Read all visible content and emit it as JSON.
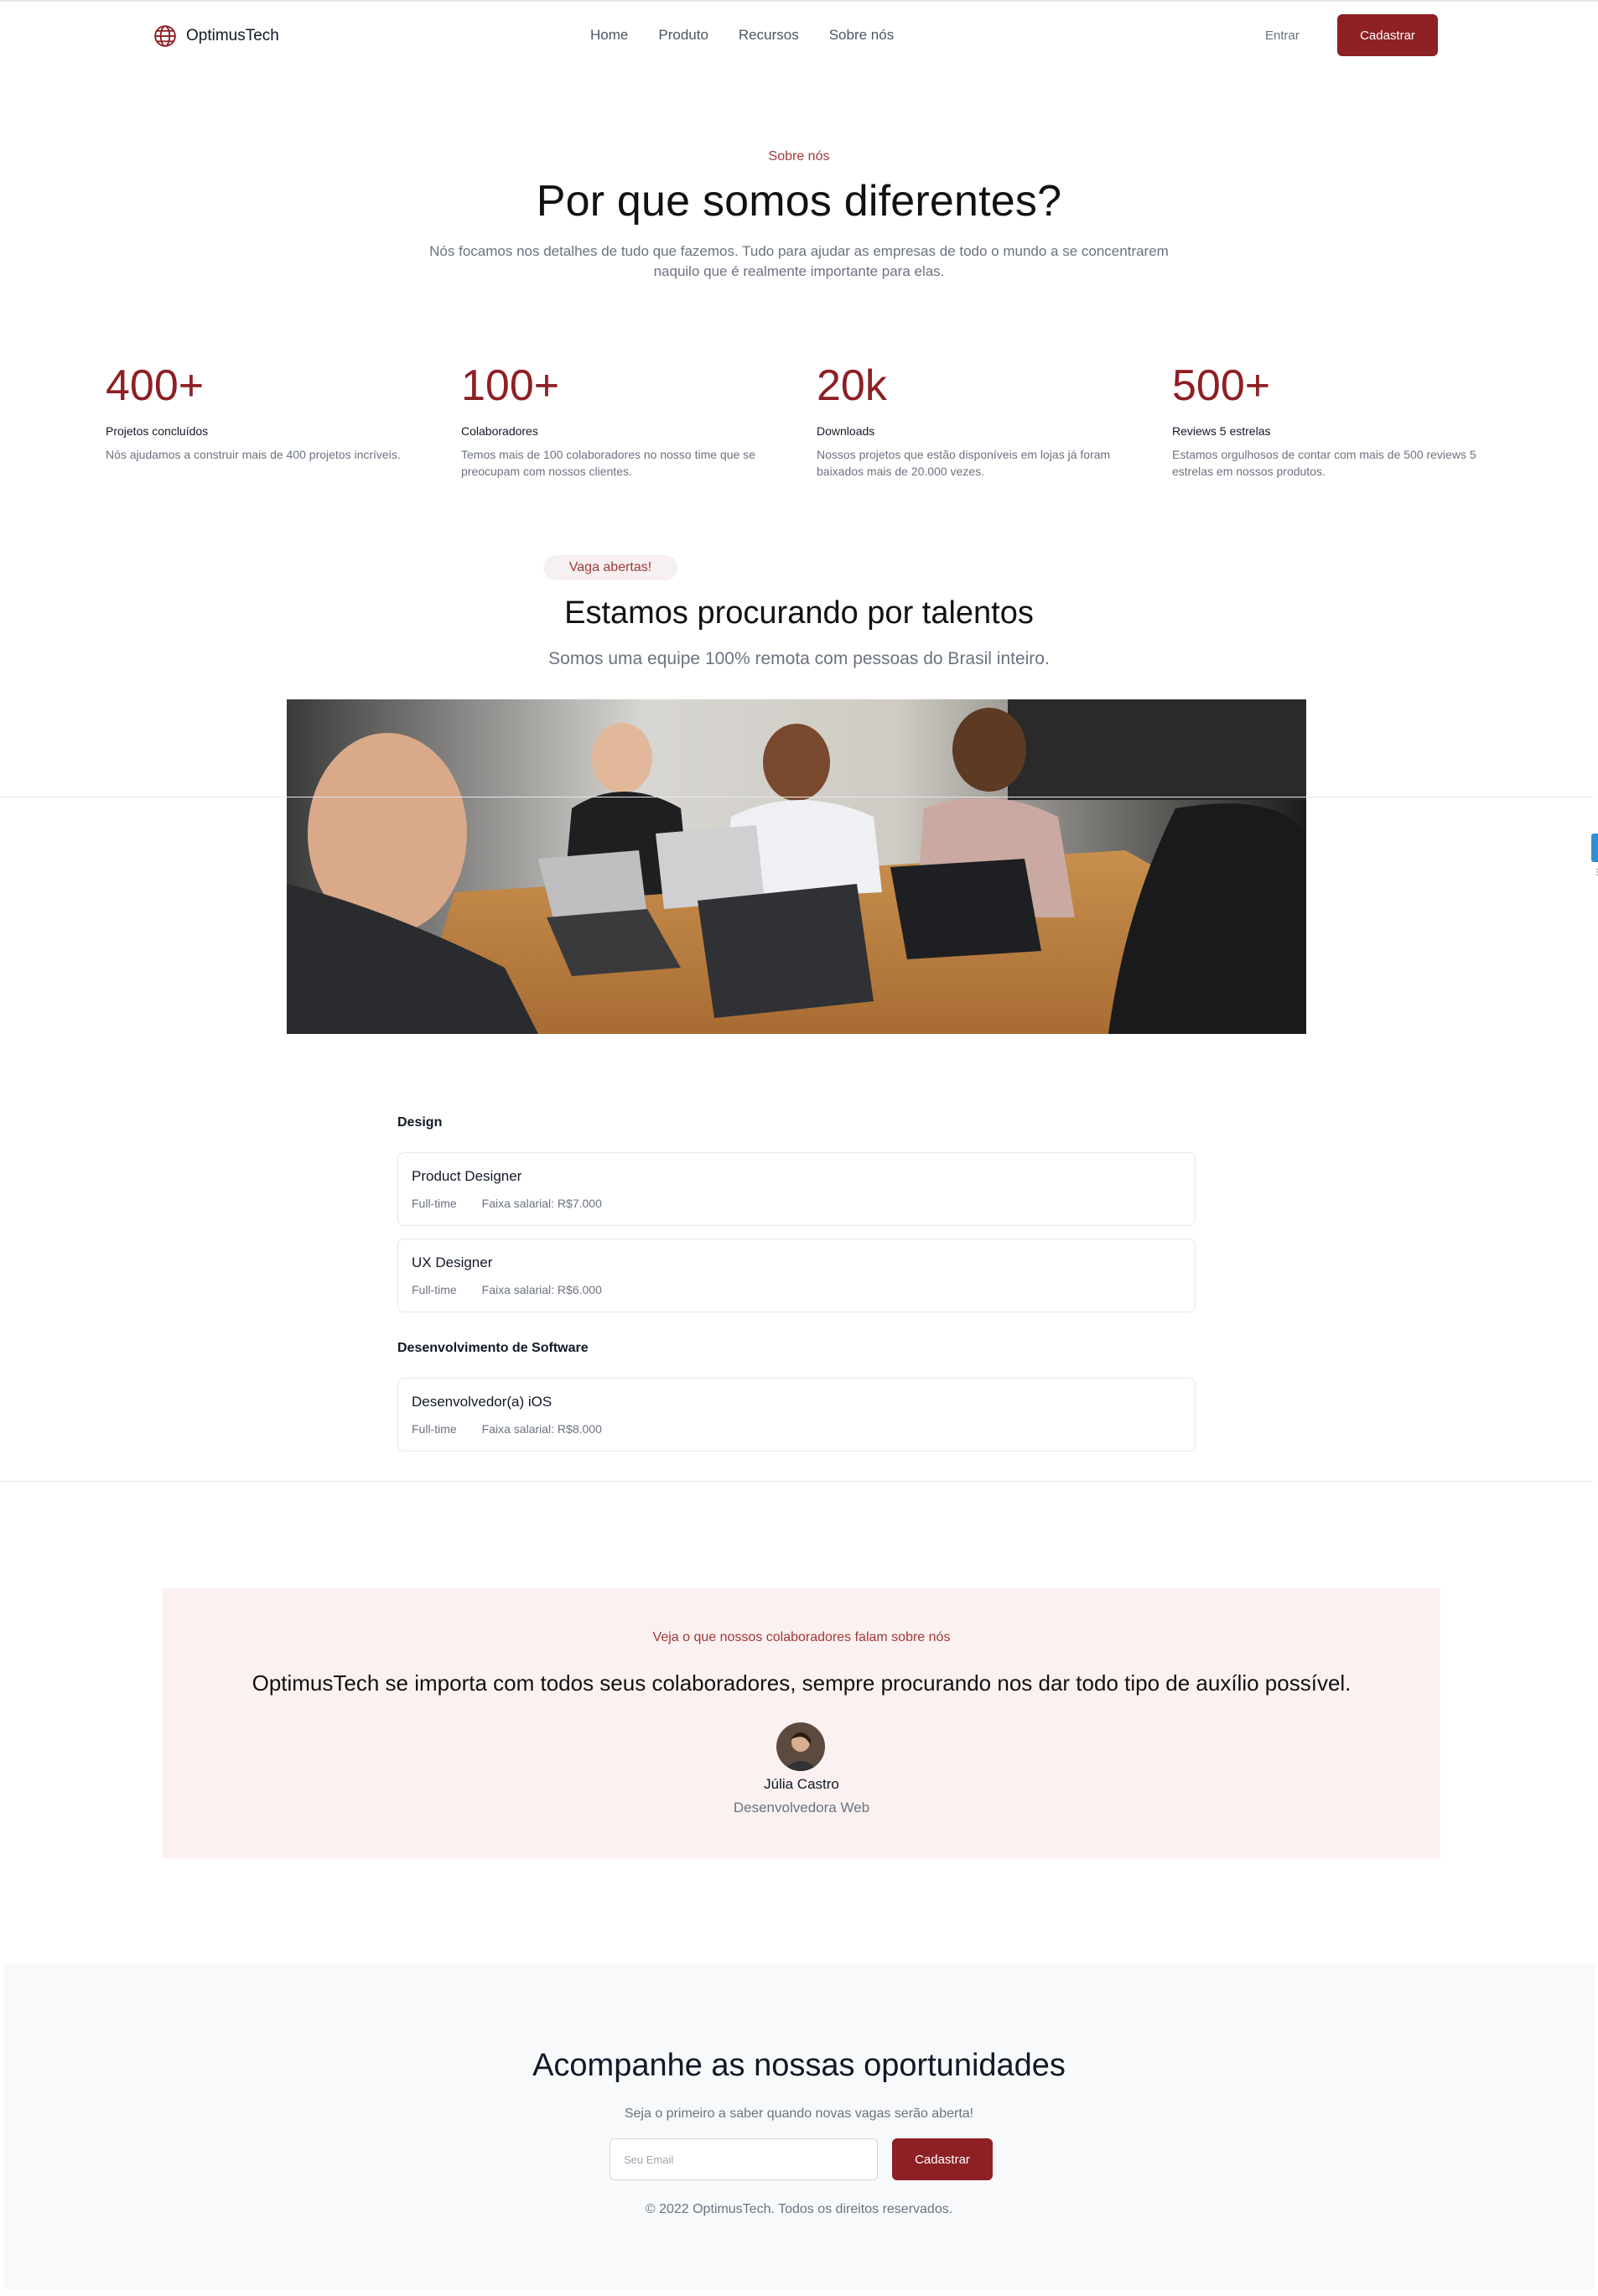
{
  "brand": {
    "name": "OptimusTech",
    "accent": "#8d2024",
    "icon": "globe-icon"
  },
  "nav": {
    "links": [
      "Home",
      "Produto",
      "Recursos",
      "Sobre nós"
    ],
    "login_label": "Entrar",
    "signup_label": "Cadastrar"
  },
  "about": {
    "eyebrow": "Sobre nós",
    "title": "Por que somos diferentes?",
    "description": "Nós focamos nos detalhes de tudo que fazemos. Tudo para ajudar as empresas de todo o mundo a se concentrarem naquilo que é realmente importante para elas."
  },
  "stats": [
    {
      "value": "400+",
      "title": "Projetos concluídos",
      "description": "Nós ajudamos a construir mais de 400 projetos incríveis."
    },
    {
      "value": "100+",
      "title": "Colaboradores",
      "description": "Temos mais de 100 colaboradores no nosso time que se preocupam com nossos clientes."
    },
    {
      "value": "20k",
      "title": "Downloads",
      "description": "Nossos projetos que estão disponíveis em lojas já foram baixados mais de 20.000 vezes."
    },
    {
      "value": "500+",
      "title": "Reviews 5 estrelas",
      "description": "Estamos orgulhosos de contar com mais de 500 reviews 5 estrelas em nossos produtos."
    }
  ],
  "careers": {
    "badge": "Vaga abertas!",
    "title": "Estamos procurando por talentos",
    "subtitle": "Somos uma equipe 100% remota com pessoas do Brasil inteiro."
  },
  "departments": [
    {
      "name": "Design",
      "jobs": [
        {
          "title": "Product Designer",
          "type": "Full-time",
          "salary": "Faixa salarial: R$7.000"
        },
        {
          "title": "UX Designer",
          "type": "Full-time",
          "salary": "Faixa salarial: R$6.000"
        }
      ]
    },
    {
      "name": "Desenvolvimento de Software",
      "jobs": [
        {
          "title": "Desenvolvedor(a) iOS",
          "type": "Full-time",
          "salary": "Faixa salarial: R$8.000"
        }
      ]
    }
  ],
  "testimonial": {
    "eyebrow": "Veja o que nossos colaboradores falam sobre nós",
    "quote": "OptimusTech se importa com todos seus colaboradores, sempre procurando nos dar todo tipo de auxílio possível.",
    "name": "Júlia Castro",
    "role": "Desenvolvedora Web"
  },
  "newsletter": {
    "title": "Acompanhe as nossas oportunidades",
    "subtitle": "Seja o primeiro a saber quando novas vagas serão aberta!",
    "email_placeholder": "Seu Email",
    "button_label": "Cadastrar"
  },
  "footer": {
    "copyright": "© 2022 OptimusTech. Todos os direitos reservados."
  }
}
